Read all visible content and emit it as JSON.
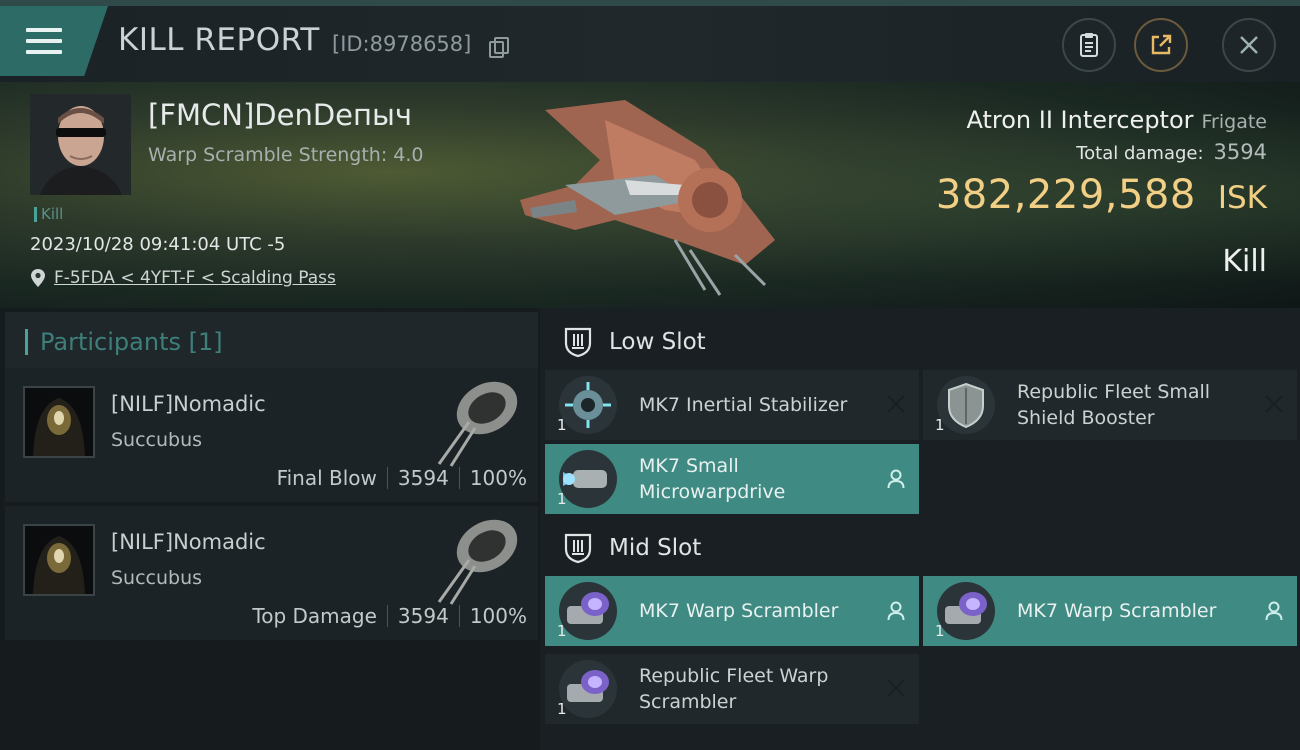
{
  "header": {
    "title": "KILL REPORT",
    "report_id": "[ID:8978658]"
  },
  "victim": {
    "pilot": "[FMCN]DenDепыч",
    "warp_scramble": "Warp Scramble Strength: 4.0",
    "tag": "Kill",
    "datetime": "2023/10/28 09:41:04 UTC -5",
    "location": "F-5FDA < 4YFT-F < Scalding Pass",
    "ship_name": "Atron II Interceptor",
    "ship_class": "Frigate",
    "total_damage_label": "Total damage:",
    "total_damage": "3594",
    "isk_value": "382,229,588",
    "isk_unit": "ISK",
    "result": "Kill"
  },
  "participants": {
    "label": "Participants [1]",
    "rows": [
      {
        "name": "[NILF]Nomadic",
        "ship": "Succubus",
        "role": "Final Blow",
        "damage": "3594",
        "percent": "100%"
      },
      {
        "name": "[NILF]Nomadic",
        "ship": "Succubus",
        "role": "Top Damage",
        "damage": "3594",
        "percent": "100%"
      }
    ]
  },
  "slots": {
    "low_label": "Low Slot",
    "mid_label": "Mid Slot",
    "modules": [
      {
        "name": "MK7 Inertial Stabilizer",
        "qty": "1",
        "state": "destroyed"
      },
      {
        "name": "Republic Fleet Small Shield Booster",
        "qty": "1",
        "state": "destroyed"
      },
      {
        "name": "MK7 Small Microwarpdrive",
        "qty": "1",
        "state": "dropped"
      },
      {
        "name": "MK7 Warp Scrambler",
        "qty": "1",
        "state": "dropped"
      },
      {
        "name": "MK7 Warp Scrambler",
        "qty": "1",
        "state": "dropped"
      },
      {
        "name": "Republic Fleet Warp Scrambler",
        "qty": "1",
        "state": "destroyed"
      }
    ]
  },
  "colors": {
    "accent": "#3f8a82",
    "isk": "#f1cf84",
    "panel": "#20282b"
  }
}
